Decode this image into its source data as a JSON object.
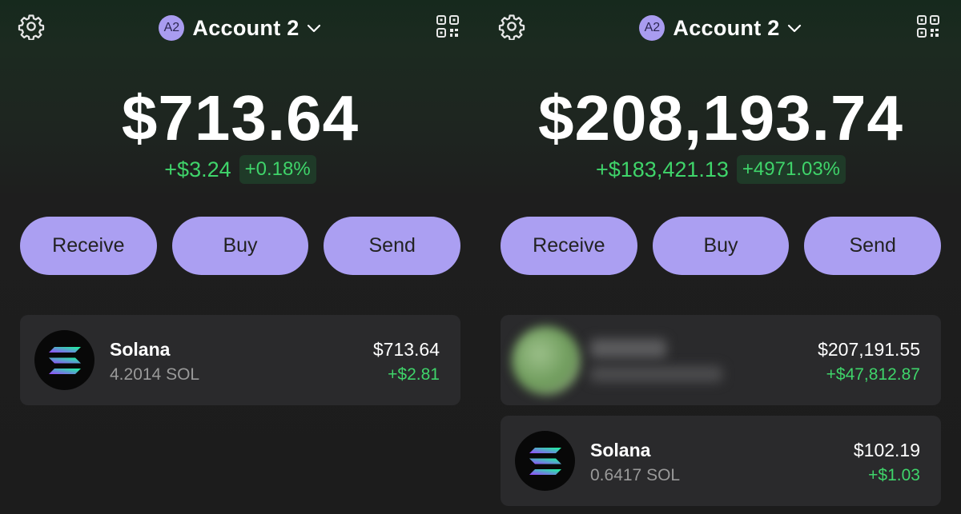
{
  "screens": [
    {
      "account": {
        "badge": "A2",
        "name": "Account 2"
      },
      "balance": "$713.64",
      "change": {
        "amount": "+$3.24",
        "percent": "+0.18%"
      },
      "actions": {
        "receive": "Receive",
        "buy": "Buy",
        "send": "Send"
      },
      "tokens": [
        {
          "name": "Solana",
          "amount": "4.2014 SOL",
          "value": "$713.64",
          "change": "+$2.81"
        }
      ]
    },
    {
      "account": {
        "badge": "A2",
        "name": "Account 2"
      },
      "balance": "$208,193.74",
      "change": {
        "amount": "+$183,421.13",
        "percent": "+4971.03%"
      },
      "actions": {
        "receive": "Receive",
        "buy": "Buy",
        "send": "Send"
      },
      "tokens": [
        {
          "name": "",
          "amount": "",
          "value": "$207,191.55",
          "change": "+$47,812.87",
          "blurred": true
        },
        {
          "name": "Solana",
          "amount": "0.6417 SOL",
          "value": "$102.19",
          "change": "+$1.03"
        }
      ]
    }
  ],
  "colors": {
    "accent": "#ab9ff2",
    "positive": "#3fd46a",
    "card": "#2a2a2c",
    "background": "#1c1c1c"
  },
  "icons": [
    "gear-icon",
    "qr-code-icon",
    "chevron-down-icon",
    "solana-logo-icon"
  ]
}
